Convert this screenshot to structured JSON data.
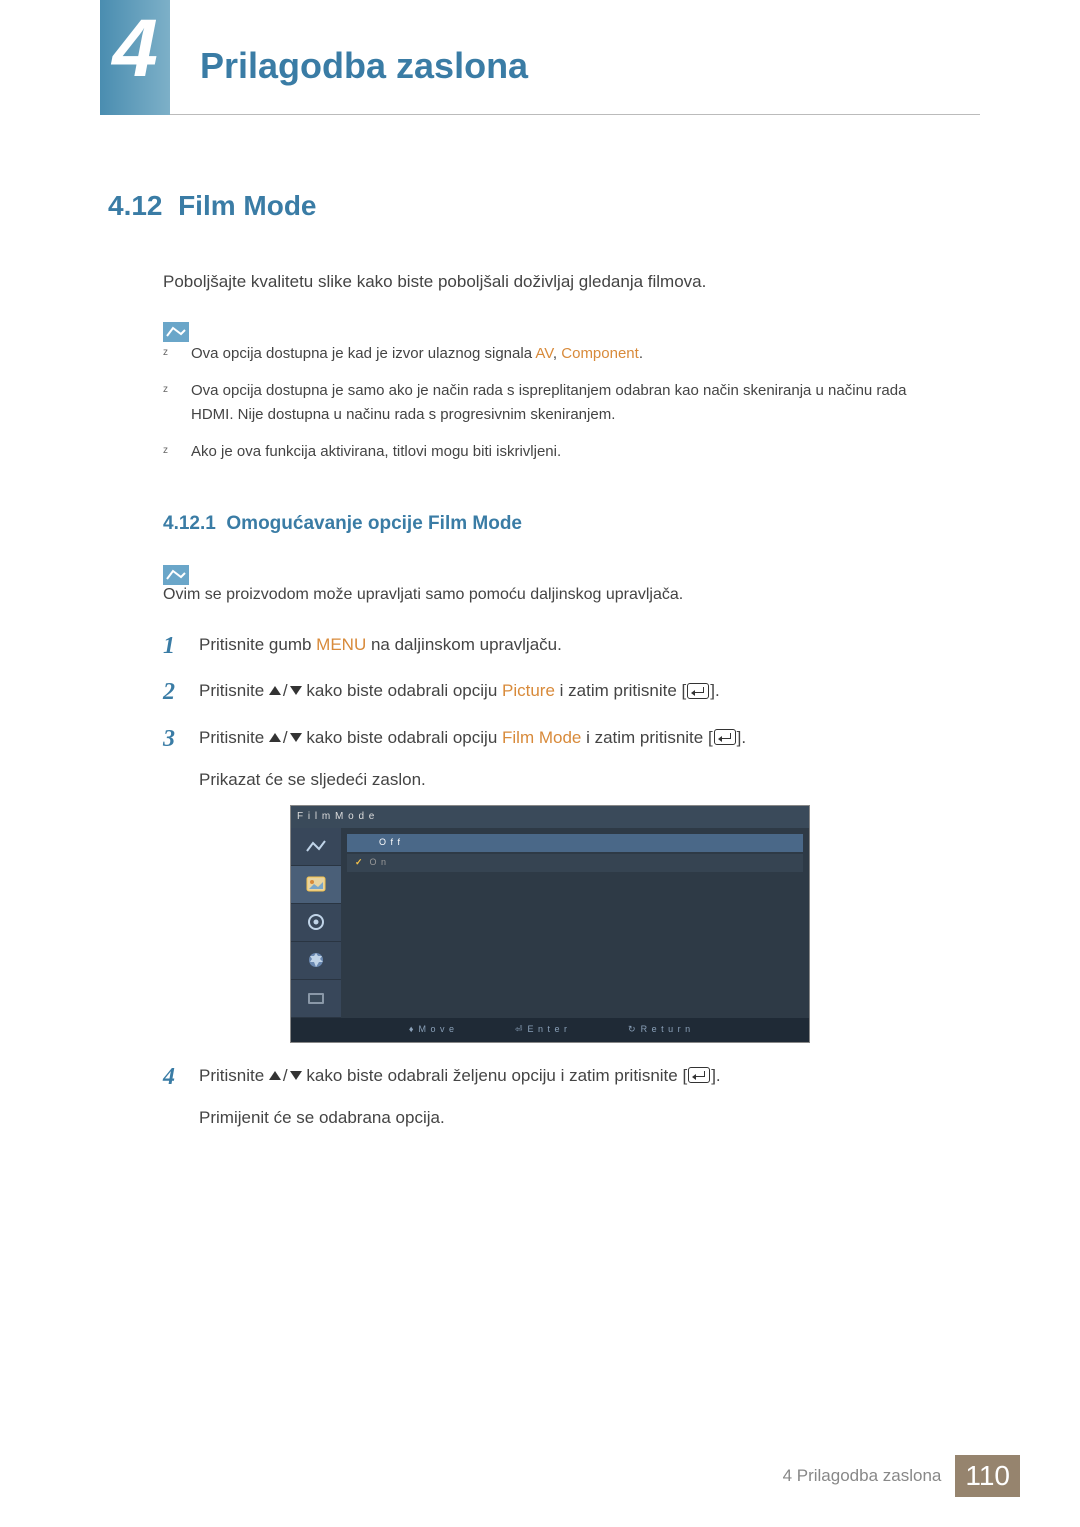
{
  "header": {
    "chapter_num": "4",
    "chapter_title": "Prilagodba zaslona"
  },
  "section": {
    "number": "4.12",
    "title": "Film Mode",
    "intro": "Poboljšajte kvalitetu slike kako biste poboljšali doživljaj gledanja filmova.",
    "notes": [
      {
        "pre": "Ova opcija dostupna je kad je izvor ulaznog signala ",
        "hl1": "AV",
        "mid": ", ",
        "hl2": "Component",
        "post": "."
      },
      {
        "pre": "Ova opcija dostupna je samo ako je način rada s ispreplitanjem odabran kao način skeniranja u načinu rada HDMI. Nije dostupna u načinu rada s progresivnim skeniranjem.",
        "hl1": "",
        "mid": "",
        "hl2": "",
        "post": ""
      },
      {
        "pre": "Ako je ova funkcija aktivirana, titlovi mogu biti iskrivljeni.",
        "hl1": "",
        "mid": "",
        "hl2": "",
        "post": ""
      }
    ]
  },
  "subsection": {
    "number": "4.12.1",
    "title": "Omogućavanje opcije Film Mode",
    "single_note": "Ovim se proizvodom može upravljati samo pomoću daljinskog upravljača.",
    "steps": {
      "s1": {
        "pre": "Pritisnite gumb ",
        "hl": "MENU",
        "post": " na daljinskom upravljaču."
      },
      "s2": {
        "pre": "Pritisnite ",
        "mid": " kako biste odabrali opciju ",
        "hl": "Picture",
        "post": " i zatim pritisnite [",
        "tail": "]."
      },
      "s3": {
        "pre": "Pritisnite ",
        "mid": " kako biste odabrali opciju ",
        "hl": "Film Mode",
        "post": " i zatim pritisnite [",
        "tail": "].",
        "after": "Prikazat će se sljedeći zaslon."
      },
      "s4": {
        "pre": "Pritisnite ",
        "mid": " kako biste odabrali željenu opciju i zatim pritisnite [",
        "tail": "].",
        "after": "Primijenit će se odabrana opcija."
      }
    }
  },
  "osd": {
    "header": "F i l m   M o d e",
    "row_off": "O f f",
    "row_on": "O n",
    "footer_move": "M o v e",
    "footer_enter": "E n t e r",
    "footer_return": "R e t u r n"
  },
  "footer": {
    "chapter_label": "4 Prilagodba zaslona",
    "page_num": "110"
  }
}
